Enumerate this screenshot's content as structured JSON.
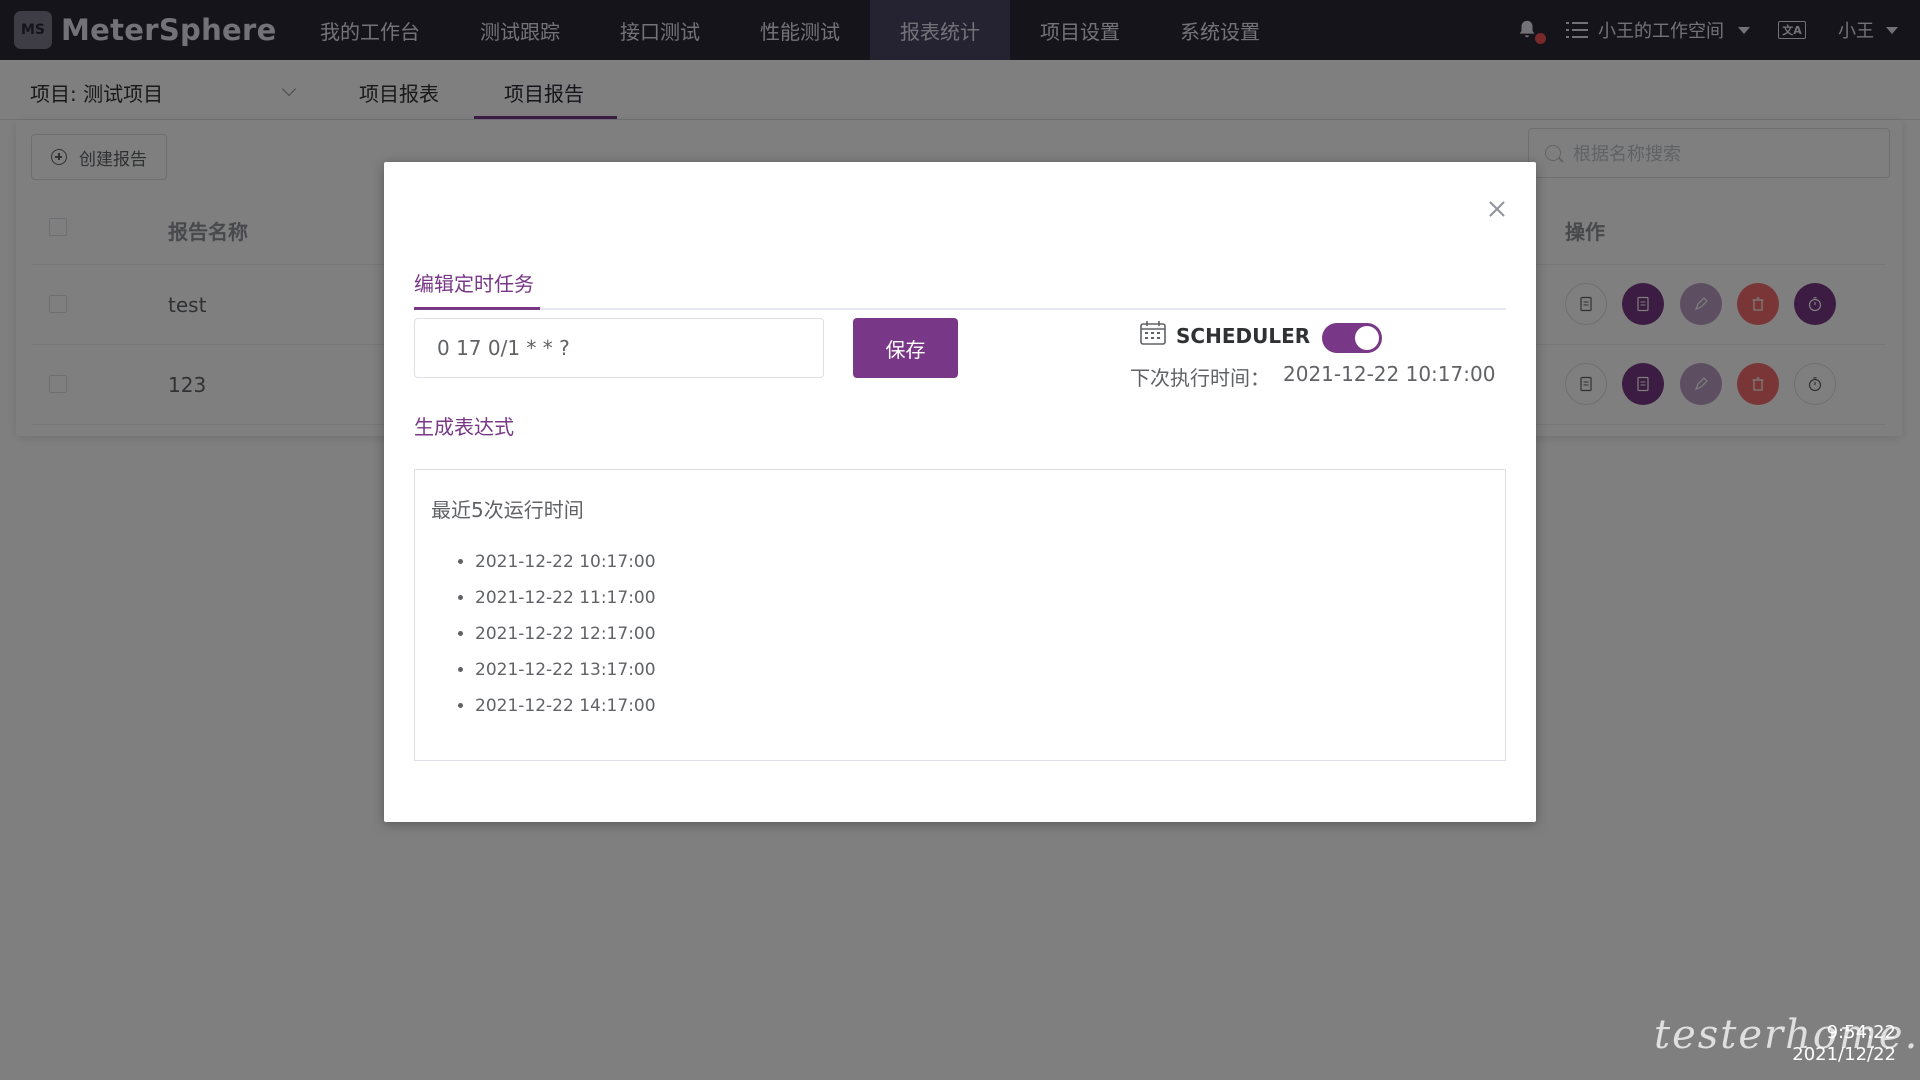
{
  "app": {
    "name": "MeterSphere"
  },
  "nav": {
    "items": [
      {
        "label": "我的工作台",
        "active": false
      },
      {
        "label": "测试跟踪",
        "active": false
      },
      {
        "label": "接口测试",
        "active": false
      },
      {
        "label": "性能测试",
        "active": false
      },
      {
        "label": "报表统计",
        "active": true
      },
      {
        "label": "项目设置",
        "active": false
      },
      {
        "label": "系统设置",
        "active": false
      }
    ],
    "workspace": "小王的工作空间",
    "user": "小王",
    "lang_icon": "文A"
  },
  "subheader": {
    "project_select": "项目: 测试项目",
    "tabs": [
      {
        "label": "项目报表",
        "active": false
      },
      {
        "label": "项目报告",
        "active": true
      }
    ]
  },
  "page": {
    "create_button": "创建报告",
    "search_placeholder": "根据名称搜索",
    "table": {
      "headers": {
        "name": "报告名称",
        "actions": "操作"
      },
      "rows": [
        {
          "name": "test"
        },
        {
          "name": "123"
        }
      ]
    }
  },
  "dialog": {
    "tab_label": "编辑定时任务",
    "cron_value": "0 17 0/1 * * ?",
    "save_label": "保存",
    "scheduler_label": "SCHEDULER",
    "scheduler_enabled": true,
    "next_exec_label": "下次执行时间：",
    "next_exec_value": "2021-12-22 10:17:00",
    "generate_label": "生成表达式",
    "recent_runs_title": "最近5次运行时间",
    "recent_runs": [
      "2021-12-22 10:17:00",
      "2021-12-22 11:17:00",
      "2021-12-22 12:17:00",
      "2021-12-22 13:17:00",
      "2021-12-22 14:17:00"
    ]
  },
  "watermark": "testerhome.com",
  "clock": {
    "time": "9:54:22",
    "date": "2021/12/22"
  },
  "colors": {
    "accent": "#783887",
    "nav_bg": "#2b2936",
    "danger": "#f56c6c"
  }
}
